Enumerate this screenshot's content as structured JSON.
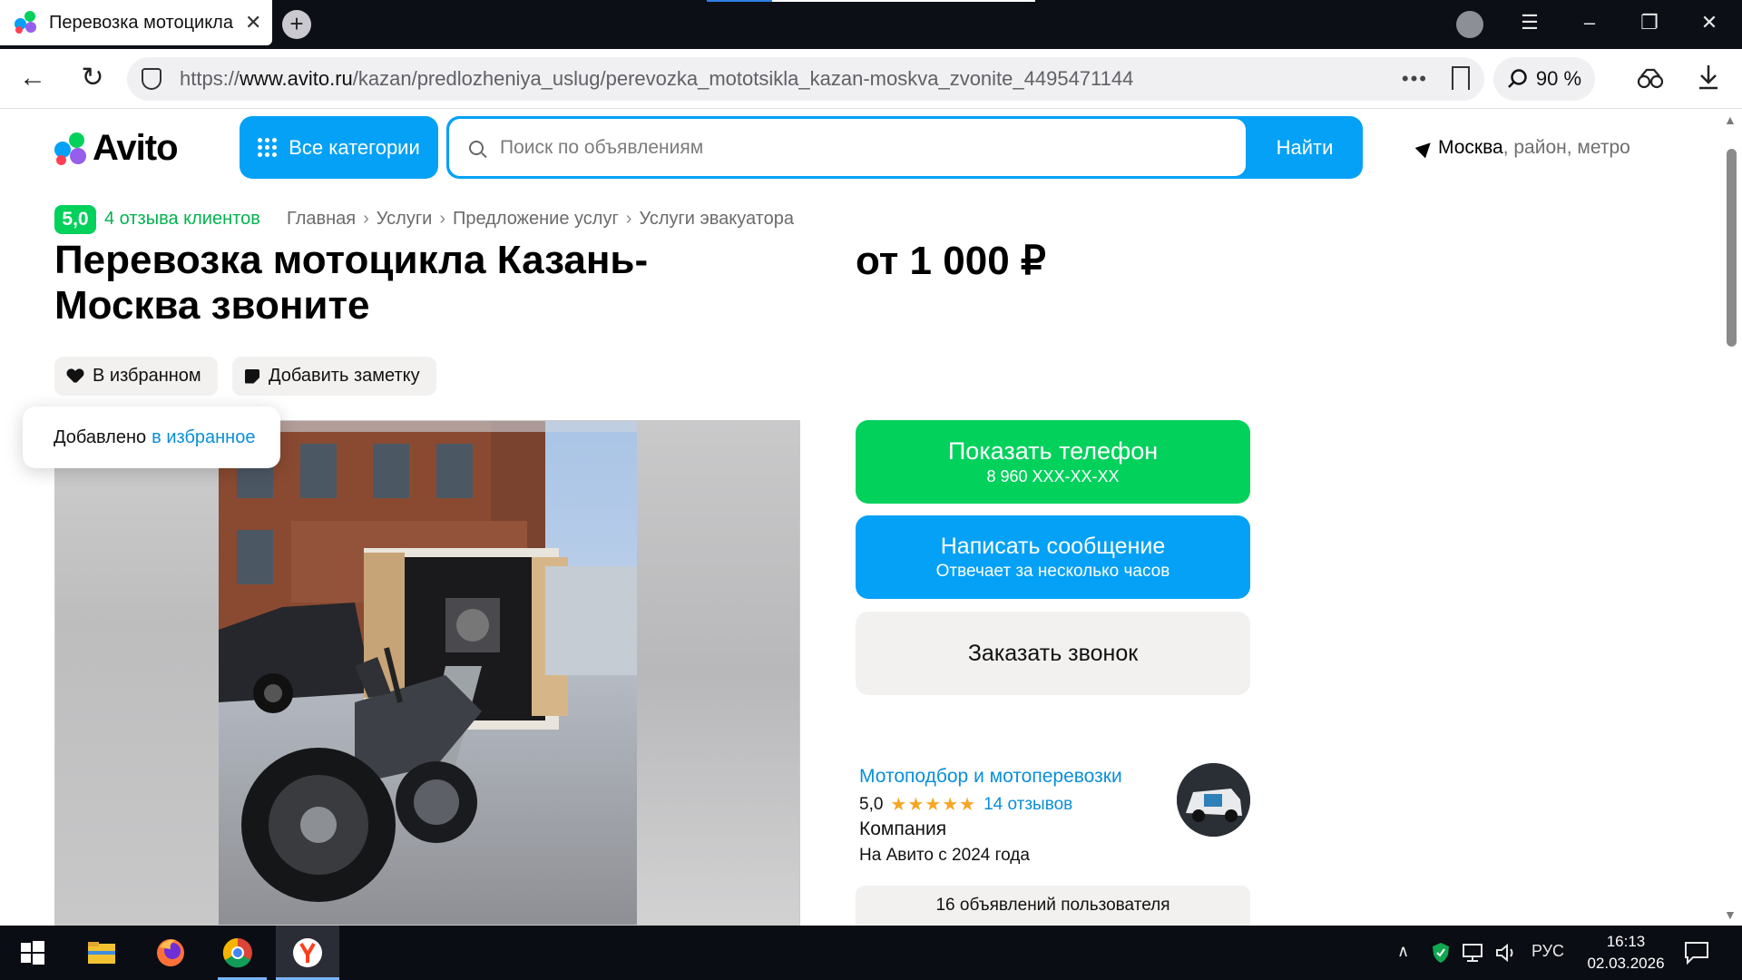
{
  "browser": {
    "tab_title": "Перевозка мотоцикла",
    "tab_close": "✕",
    "new_tab": "+",
    "url_prefix": "https://",
    "url_domain": "www.avito.ru",
    "url_path": "/kazan/predlozheniya_uslug/perevozka_mototsikla_kazan-moskva_zvonite_4495471144",
    "zoom": "90 %",
    "url_more": "•••"
  },
  "header": {
    "logo": "Avito",
    "categories_button": "Все категории",
    "search_placeholder": "Поиск по объявлениям",
    "search_button": "Найти",
    "location_city": "Москва",
    "location_rest": ", район, метро"
  },
  "listing": {
    "rating": "5,0",
    "reviews_link": "4 отзыва клиентов",
    "breadcrumbs": [
      "Главная",
      "Услуги",
      "Предложение услуг",
      "Услуги эвакуатора"
    ],
    "breadcrumb_sep": "›",
    "title": "Перевозка мотоцикла Казань-Москва звоните",
    "price": "от 1 000 ₽",
    "favorite_button": "В избранном",
    "note_button": "Добавить заметку",
    "toast_text": "Добавлено",
    "toast_link": "в избранное"
  },
  "actions": {
    "phone_main": "Показать телефон",
    "phone_sub": "8 960 XXX-XX-XX",
    "message_main": "Написать сообщение",
    "message_sub": "Отвечает за несколько часов",
    "call_main": "Заказать звонок"
  },
  "seller": {
    "name": "Мотоподбор и мотоперевозки",
    "rating": "5,0",
    "stars": "★★★★★",
    "reviews": "14 отзывов",
    "type": "Компания",
    "since": "На Авито с 2024 года",
    "ads_count": "16 объявлений пользователя"
  },
  "taskbar": {
    "language": "РУС",
    "time": "16:13",
    "date": "02.03.2026"
  },
  "colors": {
    "avito_blue": "#04a1f6",
    "avito_green": "#02d15c",
    "link_blue": "#0a8fd9",
    "star": "#f5a623"
  },
  "icons": [
    "windows-start-icon",
    "file-explorer-icon",
    "firefox-icon",
    "chrome-icon",
    "yandex-browser-icon",
    "back-icon",
    "reload-icon",
    "shield-icon",
    "bookmark-icon",
    "search-icon",
    "download-icon"
  ]
}
